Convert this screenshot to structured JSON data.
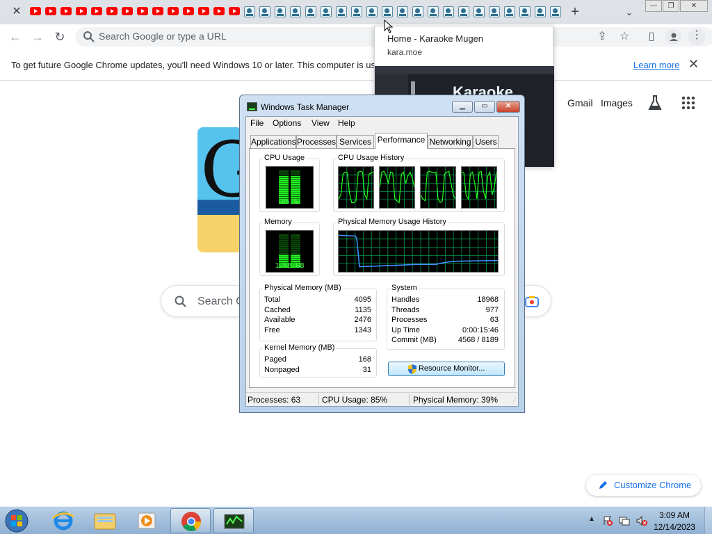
{
  "browser": {
    "tabs_youtube_count": 14,
    "tabs_karaoke_count": 21,
    "new_tab": "+",
    "omnibox_placeholder": "Search Google or type a URL",
    "infobar_text": "To get future Google Chrome updates, you'll need Windows 10 or later. This computer is us",
    "infobar_link": "Learn more"
  },
  "hovercard": {
    "title": "Home - Karaoke Mugen",
    "url": "kara.moe",
    "preview_brand": "Karaoke"
  },
  "google": {
    "links": [
      "Gmail",
      "Images"
    ],
    "search_placeholder": "Search G",
    "customize_label": "Customize Chrome"
  },
  "taskmanager": {
    "title": "Windows Task Manager",
    "menu": [
      "File",
      "Options",
      "View",
      "Help"
    ],
    "tabs": [
      "Applications",
      "Processes",
      "Services",
      "Performance",
      "Networking",
      "Users"
    ],
    "active_tab": "Performance",
    "cpu_usage_label": "CPU Usage",
    "cpu_usage_value": "85 %",
    "cpu_usage_fraction": 0.85,
    "cpu_history_label": "CPU Usage History",
    "memory_label": "Memory",
    "memory_value": "1.58 GB",
    "memory_fraction": 0.39,
    "phys_history_label": "Physical Memory Usage History",
    "physical_memory": {
      "label": "Physical Memory (MB)",
      "rows": [
        {
          "k": "Total",
          "v": "4095"
        },
        {
          "k": "Cached",
          "v": "1135"
        },
        {
          "k": "Available",
          "v": "2476"
        },
        {
          "k": "Free",
          "v": "1343"
        }
      ]
    },
    "kernel_memory": {
      "label": "Kernel Memory (MB)",
      "rows": [
        {
          "k": "Paged",
          "v": "168"
        },
        {
          "k": "Nonpaged",
          "v": "31"
        }
      ]
    },
    "system": {
      "label": "System",
      "rows": [
        {
          "k": "Handles",
          "v": "18968"
        },
        {
          "k": "Threads",
          "v": "977"
        },
        {
          "k": "Processes",
          "v": "63"
        },
        {
          "k": "Up Time",
          "v": "0:00:15:46"
        },
        {
          "k": "Commit (MB)",
          "v": "4568 / 8189"
        }
      ]
    },
    "resource_monitor_button": "Resource Monitor...",
    "status": {
      "processes": "Processes: 63",
      "cpu": "CPU Usage: 85%",
      "memory": "Physical Memory: 39%"
    }
  },
  "taskbar": {
    "time": "3:09 AM",
    "date": "12/14/2023"
  },
  "colors": {
    "graph_green": "#22ff22",
    "graph_grid": "#008040",
    "memory_line": "#3f8fff",
    "link_blue": "#1a73e8",
    "youtube_red": "#ff0000"
  }
}
